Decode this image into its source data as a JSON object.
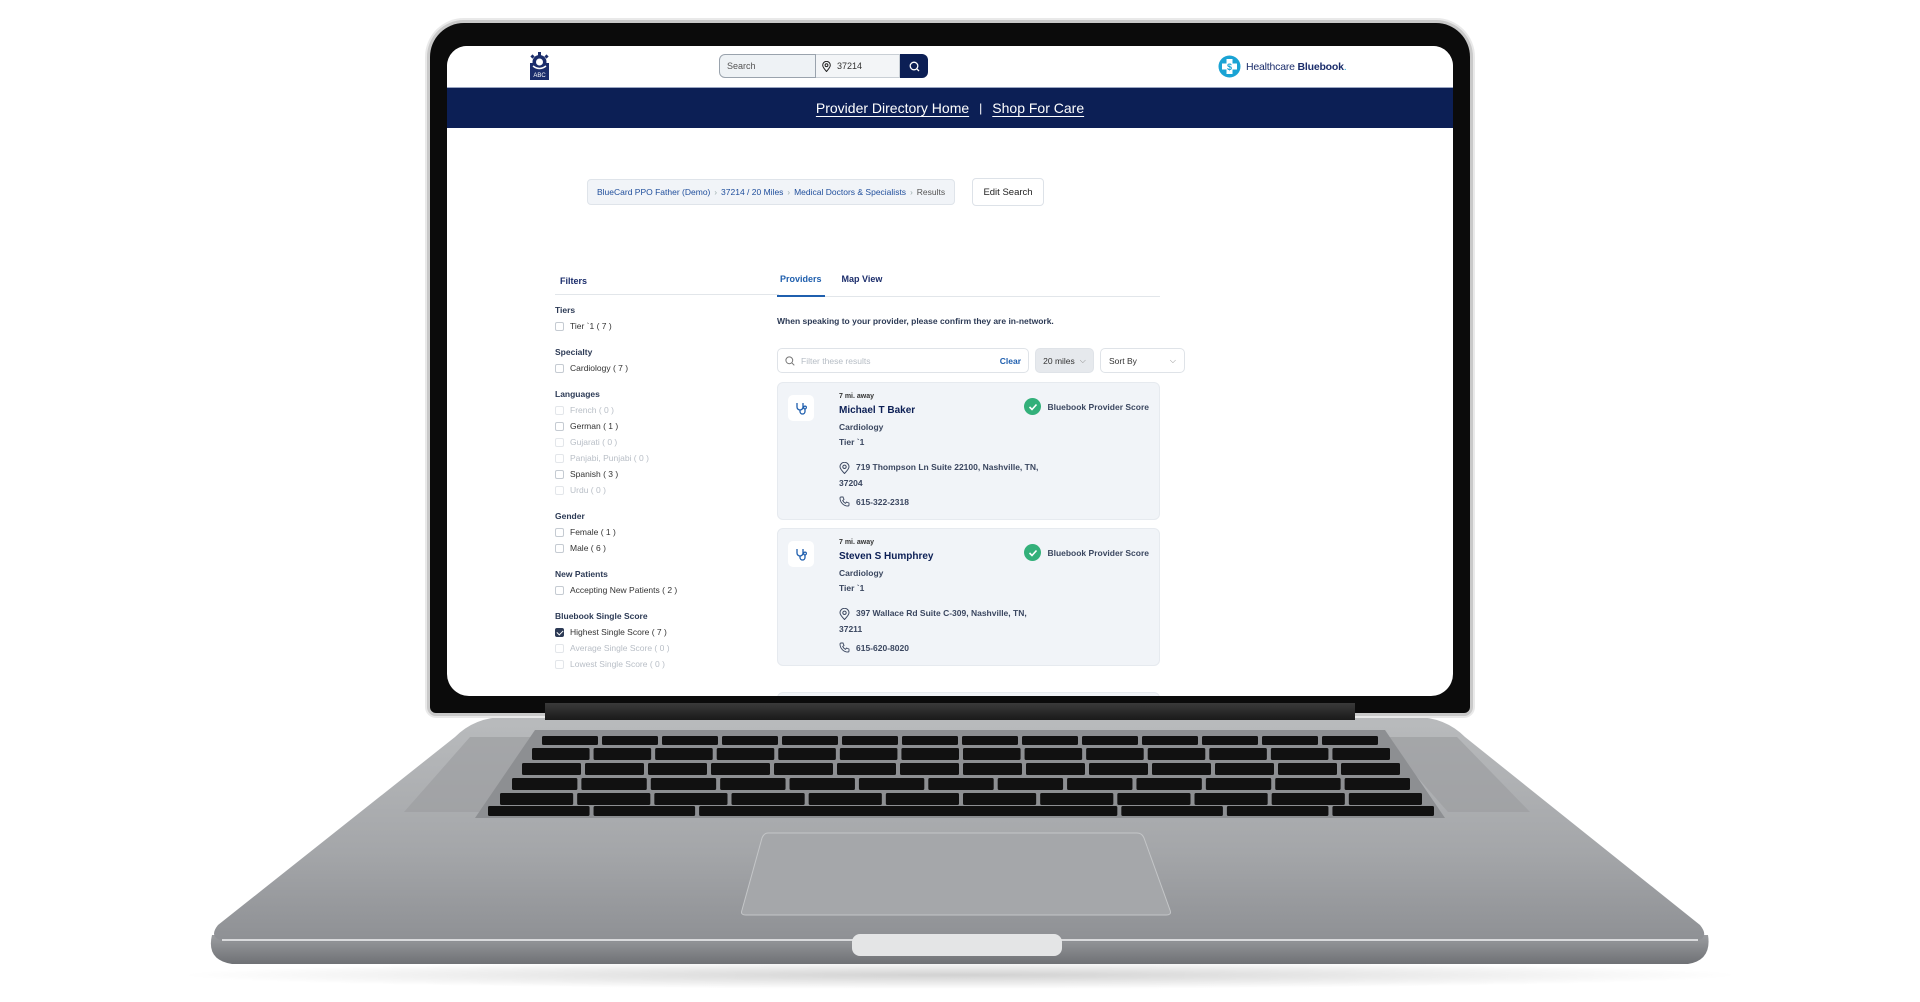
{
  "header": {
    "org_logo": "abc-gear-logo",
    "search_placeholder": "Search",
    "zip_value": "37214",
    "brand_name_light": "Healthcare ",
    "brand_name_bold": "Bluebook",
    "brand_suffix": "."
  },
  "nav": {
    "links": [
      {
        "label": "Provider Directory Home"
      },
      {
        "label": "Shop For Care"
      }
    ],
    "separator": "|"
  },
  "breadcrumb": {
    "items": [
      {
        "label": "BlueCard PPO Father (Demo)"
      },
      {
        "label": "37214 / 20 Miles"
      },
      {
        "label": "Medical Doctors & Specialists"
      }
    ],
    "current": "Results",
    "separator": "›"
  },
  "edit_search_label": "Edit Search",
  "filters": {
    "title": "Filters",
    "groups": [
      {
        "title": "Tiers",
        "options": [
          {
            "label": "Tier `1 ( 7 )",
            "disabled": false,
            "checked": false
          }
        ]
      },
      {
        "title": "Specialty",
        "options": [
          {
            "label": "Cardiology ( 7 )",
            "disabled": false,
            "checked": false
          }
        ]
      },
      {
        "title": "Languages",
        "options": [
          {
            "label": "French ( 0 )",
            "disabled": true,
            "checked": false
          },
          {
            "label": "German ( 1 )",
            "disabled": false,
            "checked": false
          },
          {
            "label": "Gujarati ( 0 )",
            "disabled": true,
            "checked": false
          },
          {
            "label": "Panjabi, Punjabi ( 0 )",
            "disabled": true,
            "checked": false
          },
          {
            "label": "Spanish ( 3 )",
            "disabled": false,
            "checked": false
          },
          {
            "label": "Urdu ( 0 )",
            "disabled": true,
            "checked": false
          }
        ]
      },
      {
        "title": "Gender",
        "options": [
          {
            "label": "Female ( 1 )",
            "disabled": false,
            "checked": false
          },
          {
            "label": "Male ( 6 )",
            "disabled": false,
            "checked": false
          }
        ]
      },
      {
        "title": "New Patients",
        "options": [
          {
            "label": "Accepting New Patients ( 2 )",
            "disabled": false,
            "checked": false
          }
        ]
      },
      {
        "title": "Bluebook Single Score",
        "options": [
          {
            "label": "Highest Single Score ( 7 )",
            "disabled": false,
            "checked": true
          },
          {
            "label": "Average Single Score ( 0 )",
            "disabled": true,
            "checked": false
          },
          {
            "label": "Lowest Single Score ( 0 )",
            "disabled": true,
            "checked": false
          }
        ]
      }
    ]
  },
  "tabs": [
    {
      "label": "Providers",
      "active": true
    },
    {
      "label": "Map View",
      "active": false
    }
  ],
  "notice": "When speaking to your provider, please confirm they are in-network.",
  "results_filter": {
    "placeholder": "Filter these results",
    "clear_label": "Clear",
    "distance_selected": "20 miles",
    "sort_label": "Sort By"
  },
  "providers": [
    {
      "distance": "7 mi. away",
      "name": "Michael T Baker",
      "specialty": "Cardiology",
      "tier": "Tier `1",
      "address": "719 Thompson Ln Suite 22100, Nashville, TN, 37204",
      "phone": "615-322-2318",
      "score_label": "Bluebook Provider Score"
    },
    {
      "distance": "7 mi. away",
      "name": "Steven S Humphrey",
      "specialty": "Cardiology",
      "tier": "Tier `1",
      "address": "397 Wallace Rd Suite C-309, Nashville, TN, 37211",
      "phone": "615-620-8020",
      "score_label": "Bluebook Provider Score"
    }
  ],
  "colors": {
    "navy": "#0c1f55",
    "link_blue": "#1f5fae",
    "score_green": "#33b07a",
    "card_bg": "#f1f4f8"
  }
}
